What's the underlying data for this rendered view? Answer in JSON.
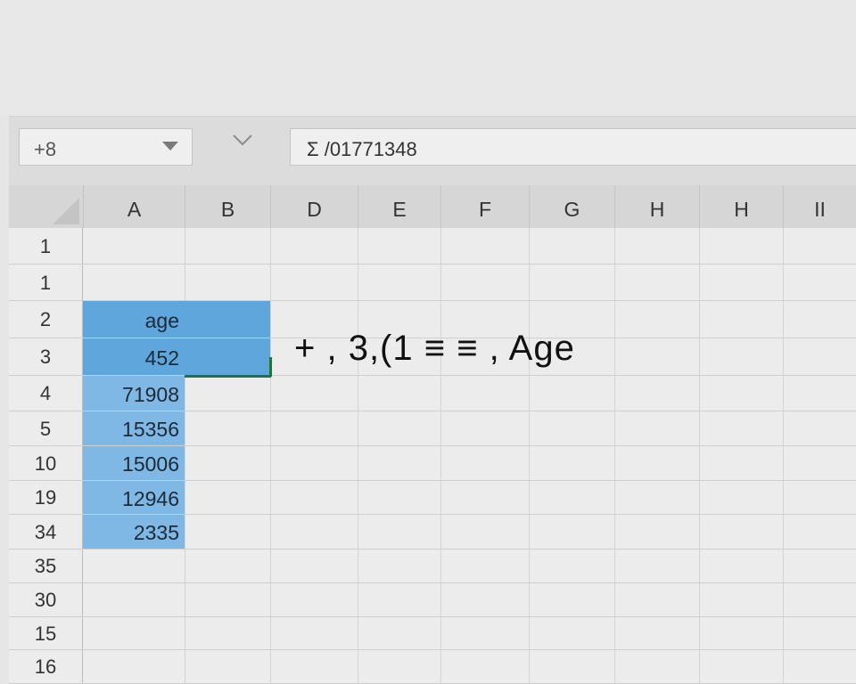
{
  "name_box": {
    "value": "+8"
  },
  "formula_bar": {
    "value": "Σ /01771348"
  },
  "columns": [
    "A",
    "B",
    "D",
    "E",
    "F",
    "G",
    "H",
    "H",
    "II"
  ],
  "rows": [
    "1",
    "1",
    "2",
    "3",
    "4",
    "5",
    "10",
    "19",
    "34",
    "35",
    "30",
    "15",
    "16"
  ],
  "column_a_values": [
    "",
    "",
    "age",
    "452",
    "71908",
    "15356",
    "15006",
    "12946",
    "2335",
    "",
    "",
    "",
    ""
  ],
  "floating_text": "+ , 3,(1 ≡ ≡ , Age",
  "colors": {
    "selection_light": "#6aaee0",
    "selection_dark": "#5fa6dc",
    "active_border": "#217346"
  }
}
